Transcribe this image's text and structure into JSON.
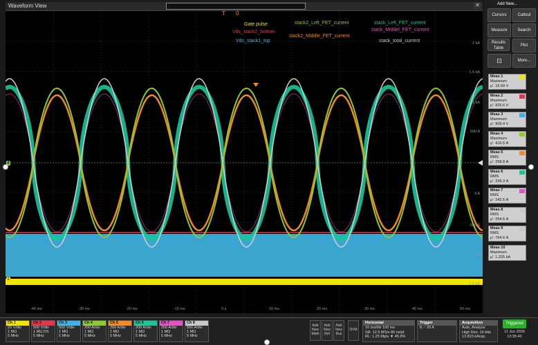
{
  "window": {
    "title": "Waveform View",
    "close": "✕"
  },
  "markers": {
    "trigger_t": "T",
    "t0": "0"
  },
  "traces": {
    "gate_pulse": "Gate pulse",
    "vds_stack2_bottom": "Vds_stack2_bottom",
    "vds_stack1_top": "Vds_stack1_top",
    "stack2_left": "stack2_Left_FET_current",
    "stack2_middle": "stack2_Middle_FET_current",
    "stack_left": "stack_Left_FET_current",
    "stack_middel": "stack_Middel_FET_current",
    "stack_total": "stack_total_current"
  },
  "yticks": [
    "2 kA",
    "1.5 kA",
    "1 kA",
    "500 A",
    "0 A",
    "-500 A",
    "-1 kA",
    "-1.5 kA"
  ],
  "xticks": [
    "-40 ms",
    "-30 ms",
    "-20 ms",
    "-10 ms",
    "0 s",
    "10 ms",
    "20 ms",
    "30 ms",
    "40 ms",
    "50 ms"
  ],
  "ch_markers": [
    "4",
    "1"
  ],
  "colors": {
    "ch1": "#f2e500",
    "ch2": "#e8334a",
    "ch3": "#3ab4e6",
    "ch4": "#8ccc2a",
    "ch5": "#f28a1e",
    "ch6": "#16c79a",
    "ch7": "#e64fc7",
    "ch8": "#c8c8c8"
  },
  "panel": {
    "add_new": "Add New...",
    "buttons": [
      "Cursors",
      "Callout",
      "Measure",
      "Search",
      "Results Table",
      "Plot",
      "",
      "More..."
    ],
    "measurements": [
      {
        "title": "Meas 1",
        "type": "Maximum",
        "value": "μ': 16.99 V"
      },
      {
        "title": "Meas 2",
        "type": "Maximum",
        "value": "μ': 826.6 V"
      },
      {
        "title": "Meas 3",
        "type": "Maximum",
        "value": "μ': 809.4 V"
      },
      {
        "title": "Meas 4",
        "type": "Maximum",
        "value": "μ': 416.5 A"
      },
      {
        "title": "Meas 5",
        "type": "RMS",
        "value": "μ': 258.8 A"
      },
      {
        "title": "Meas 6",
        "type": "RMS",
        "value": "μ': 239.3 A"
      },
      {
        "title": "Meas 7",
        "type": "RMS",
        "value": "μ': 242.5 A"
      },
      {
        "title": "Meas 8",
        "type": "RMS",
        "value": "μ': 254.6 A"
      },
      {
        "title": "Meas 9",
        "type": "RMS",
        "value": "μ': 764.6 A"
      },
      {
        "title": "Meas 10",
        "type": "Maximum",
        "value": "μ': 1.225 kA"
      }
    ]
  },
  "channels": [
    {
      "name": "Ch 1",
      "l1": "20 V/div",
      "l2": "1 MΩ",
      "l3": "5 MHz"
    },
    {
      "name": "Ch 2",
      "l1": "500 V/div",
      "l2": "1 MΩ  DS",
      "l3": "5 MHz"
    },
    {
      "name": "Ch 3",
      "l1": "500 V/div",
      "l2": "1 MΩ",
      "l3": "5 MHz"
    },
    {
      "name": "Ch 4",
      "l1": "200 A/div",
      "l2": "1 MΩ",
      "l3": "5 MHz"
    },
    {
      "name": "Ch 5",
      "l1": "200 A/div",
      "l2": "1 MΩ",
      "l3": "5 MHz"
    },
    {
      "name": "Ch 6",
      "l1": "200 A/div",
      "l2": "1 MΩ",
      "l3": "5 MHz"
    },
    {
      "name": "Ch 7",
      "l1": "200 A/div",
      "l2": "1 MΩ",
      "l3": "5 MHz"
    },
    {
      "name": "Ch 8",
      "l1": "500 A/div",
      "l2": "1 MΩ",
      "l3": "5 MHz"
    }
  ],
  "add_buttons": [
    "Add New Math",
    "Add New Ref",
    "Add New Bus",
    "DVM"
  ],
  "horizontal": {
    "title": "Horizontal",
    "l1": "10 ms/div      100 ms",
    "l2": "SR: 12.5 MS/s   80 ns/pt",
    "l3": "RL: 1.25 Mpts   ▼ 45.9%"
  },
  "trigger": {
    "title": "Trigger",
    "l1": "8  ⟋  20 A"
  },
  "acquisition": {
    "title": "Acquisition",
    "l1": "Auto,          Analyze",
    "l2": "High Res: 16 bits",
    "l3": "13.823 kAcqs"
  },
  "status": {
    "triggered": "Triggered",
    "date": "11 Jun 2026",
    "time": "13:35:40"
  }
}
